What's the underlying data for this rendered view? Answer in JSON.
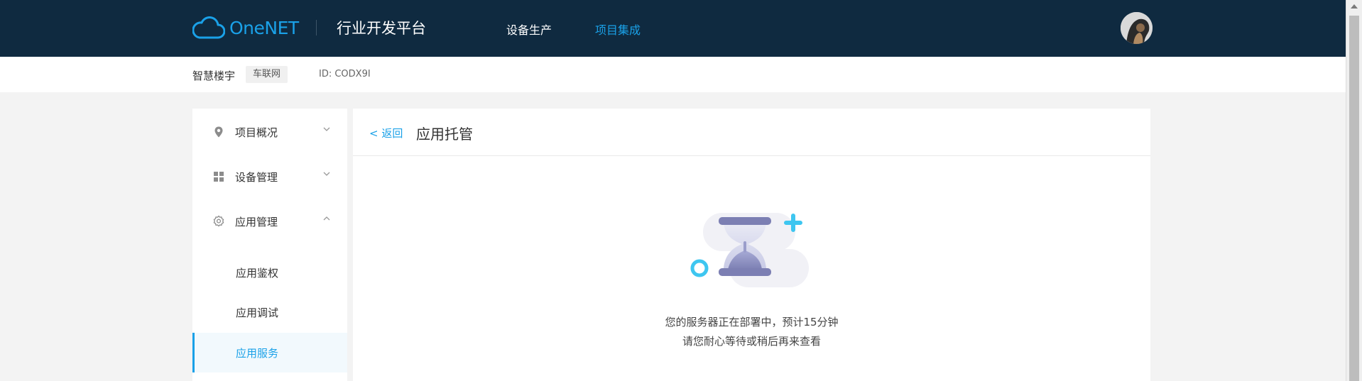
{
  "header": {
    "brand": "OneNET",
    "platform_title": "行业开发平台",
    "nav": [
      {
        "label": "设备生产",
        "active": false
      },
      {
        "label": "项目集成",
        "active": true
      }
    ]
  },
  "project": {
    "name": "智慧楼宇",
    "tag": "车联网",
    "id_text": "ID: CODX9I"
  },
  "sidebar": {
    "groups": [
      {
        "label": "项目概况",
        "icon": "location-pin-icon",
        "expanded": false
      },
      {
        "label": "设备管理",
        "icon": "grid-icon",
        "expanded": false
      },
      {
        "label": "应用管理",
        "icon": "gear-icon",
        "expanded": true
      }
    ],
    "items": [
      {
        "label": "应用鉴权",
        "active": false
      },
      {
        "label": "应用调试",
        "active": false
      },
      {
        "label": "应用服务",
        "active": true
      }
    ]
  },
  "main": {
    "back_label": "< 返回",
    "title": "应用托管",
    "message_line1": "您的服务器正在部署中，预计15分钟",
    "message_line2": "请您耐心等待或稍后再来查看"
  },
  "colors": {
    "header_bg": "#0f2a40",
    "accent": "#1aa1e8",
    "page_bg": "#f3f3f3",
    "hourglass": "#7c7fb3"
  }
}
